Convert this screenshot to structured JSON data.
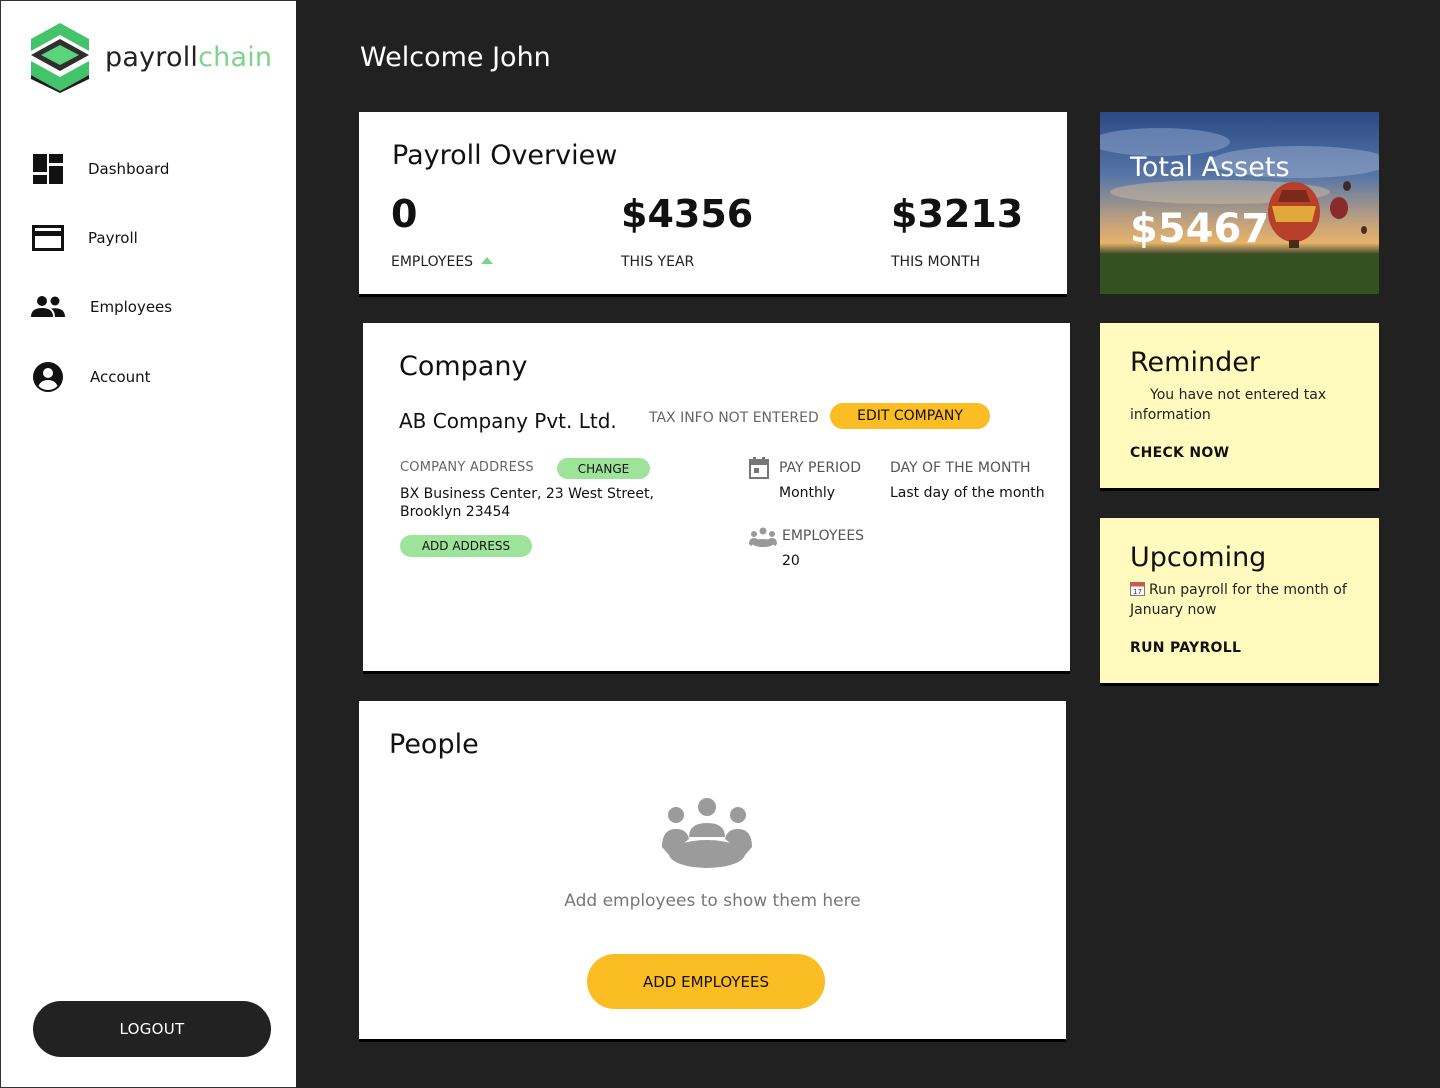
{
  "brand": {
    "part1": "payroll",
    "part2": "chain"
  },
  "sidebar": {
    "items": [
      {
        "label": "Dashboard",
        "icon": "dashboard-icon"
      },
      {
        "label": "Payroll",
        "icon": "credit-card-icon"
      },
      {
        "label": "Employees",
        "icon": "people-icon"
      },
      {
        "label": "Account",
        "icon": "account-circle-icon"
      }
    ],
    "logout_label": "LOGOUT"
  },
  "header": {
    "welcome": "Welcome John"
  },
  "overview": {
    "title": "Payroll Overview",
    "stats": [
      {
        "value": "0",
        "caption": "EMPLOYEES"
      },
      {
        "value": "$4356",
        "caption": "THIS YEAR"
      },
      {
        "value": "$3213",
        "caption": "THIS MONTH"
      }
    ]
  },
  "assets": {
    "title": "Total Assets",
    "value": "$5467"
  },
  "company": {
    "title": "Company",
    "name": "AB Company Pvt. Ltd.",
    "tax_status": "TAX INFO NOT ENTERED",
    "edit_label": "EDIT COMPANY",
    "address_label": "COMPANY ADDRESS",
    "change_label": "CHANGE",
    "address": "BX Business Center, 23 West Street, Brooklyn 23454",
    "add_address_label": "ADD ADDRESS",
    "pay_period_label": "PAY PERIOD",
    "pay_period": "Monthly",
    "day_label": "DAY OF THE MONTH",
    "day": "Last day of the month",
    "employees_label": "EMPLOYEES",
    "employees": "20"
  },
  "people": {
    "title": "People",
    "hint": "Add employees to show them here",
    "add_label": "ADD EMPLOYEES"
  },
  "reminder": {
    "title": "Reminder",
    "message": "You have not entered tax information",
    "action": "CHECK NOW"
  },
  "upcoming": {
    "title": "Upcoming",
    "message": "Run payroll for the month of January now",
    "action": "RUN PAYROLL"
  },
  "colors": {
    "accent_green": "#7ed488",
    "accent_yellow": "#fbbd24",
    "note_bg": "#fffbbe",
    "bg_dark": "#212121"
  }
}
